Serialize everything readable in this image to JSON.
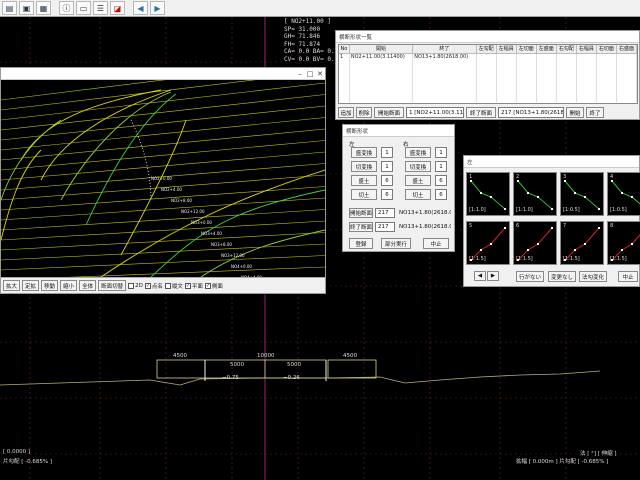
{
  "toolbar": {
    "icons": [
      "folder-icon",
      "image-icon",
      "grid-icon",
      "info-icon",
      "monitor-icon",
      "list-icon",
      "profile-icon",
      "arrow-left-icon",
      "arrow-right-icon"
    ]
  },
  "readout": {
    "station": "[ NO2+11.00 ]",
    "sp": "SP= 31.000",
    "gh": "GH= 71.846",
    "fh": "FH= 71.874",
    "cal": "CA= 0.0 BA= 0.0",
    "cvi": "CV= 0.0 BV= 0.0"
  },
  "win3d": {
    "toolbar": {
      "zoom_in": "拡大",
      "fixed": "定拡",
      "move": "移動",
      "zoom_out": "縮小",
      "all": "全体",
      "section_switch": "断面切替",
      "opt_2d": "2D",
      "opt_point": "点名",
      "opt_plan": "縦文",
      "opt_surface": "平面",
      "opt_side": "側面"
    },
    "labels": [
      "NO2+0.00",
      "NO2+4.00",
      "NO2+8.00",
      "NO2+12.00",
      "NO3+0.00",
      "NO3+4.00",
      "NO3+8.00",
      "NO3+12.00",
      "NO4+0.00",
      "NO4+4.00",
      "NO4+8.00",
      "NO4+12.00"
    ]
  },
  "tablewin": {
    "title": "横断形状一覧",
    "columns": [
      "No",
      "開始",
      "終了",
      "左勾配",
      "左幅員",
      "左切面",
      "左盛面",
      "右勾配",
      "右幅員",
      "右切面",
      "右盛面"
    ],
    "rows": [
      [
        "1",
        "NO2+11.00(3.11400)",
        "NO13+1.80(2618.00)",
        "",
        "",
        "",
        "",
        "",
        "",
        "",
        ""
      ]
    ],
    "buttons": {
      "add": "追加",
      "delete": "削除",
      "start_section": "開始断面",
      "start_value": "1 [NO2+11.00(3.11400)]",
      "end_section": "終了断面",
      "end_value": "217 [NO13+1.80(2618.00)]",
      "open": "開始",
      "close": "終了"
    }
  },
  "dialog": {
    "title": "横断形状",
    "left": "左",
    "right": "右",
    "left_items": [
      {
        "label": "盛変換",
        "value": "1"
      },
      {
        "label": "切変換",
        "value": "1"
      },
      {
        "label": "盛土",
        "value": "6"
      },
      {
        "label": "切土",
        "value": "6"
      }
    ],
    "right_items": [
      {
        "label": "盛変換",
        "value": "1"
      },
      {
        "label": "切変換",
        "value": "1"
      },
      {
        "label": "盛土",
        "value": "6"
      },
      {
        "label": "切土",
        "value": "6"
      }
    ],
    "start_section": "開始断面",
    "start_num": "217",
    "start_name": "NO13+1.80(2618.00)",
    "end_section": "終了断面",
    "end_num": "217",
    "end_name": "NO13+1.80(2618.00)",
    "ok": "登録",
    "partial": "部分実行",
    "cancel": "中止"
  },
  "profwin": {
    "title": "左",
    "cells_top": [
      {
        "id": "1",
        "label": "[1:1.0]"
      },
      {
        "id": "2",
        "label": "[1:1.0]"
      },
      {
        "id": "3",
        "label": "[1:0.5]"
      },
      {
        "id": "4",
        "label": "[1:0.5]"
      }
    ],
    "cells_bottom": [
      {
        "id": "5",
        "label": "[1:1.5]"
      },
      {
        "id": "6",
        "label": "[1:1.5]"
      },
      {
        "id": "7",
        "label": "[1:1.5]"
      },
      {
        "id": "8",
        "label": "[1:1.5]"
      }
    ],
    "buttons": {
      "prev": "◀",
      "next": "▶",
      "none": "行がない",
      "no_change": "変更なし",
      "apply": "法勾変化",
      "cancel": "中止"
    }
  },
  "cross": {
    "widths_top": [
      "4500",
      "10000",
      "4500"
    ],
    "widths_mid": [
      "5000",
      "5000"
    ],
    "slopes": [
      "−0.75",
      "−0.26"
    ],
    "left_info_1": "[ 0.0000 ]",
    "left_info_2": "片勾配 [ -0.685% ]",
    "right_info_1": "法 [ °]   [ 伸縮 ]",
    "right_info_2": "拡幅 [ 0.000m ] 片勾配 [ -0.685% ]"
  }
}
